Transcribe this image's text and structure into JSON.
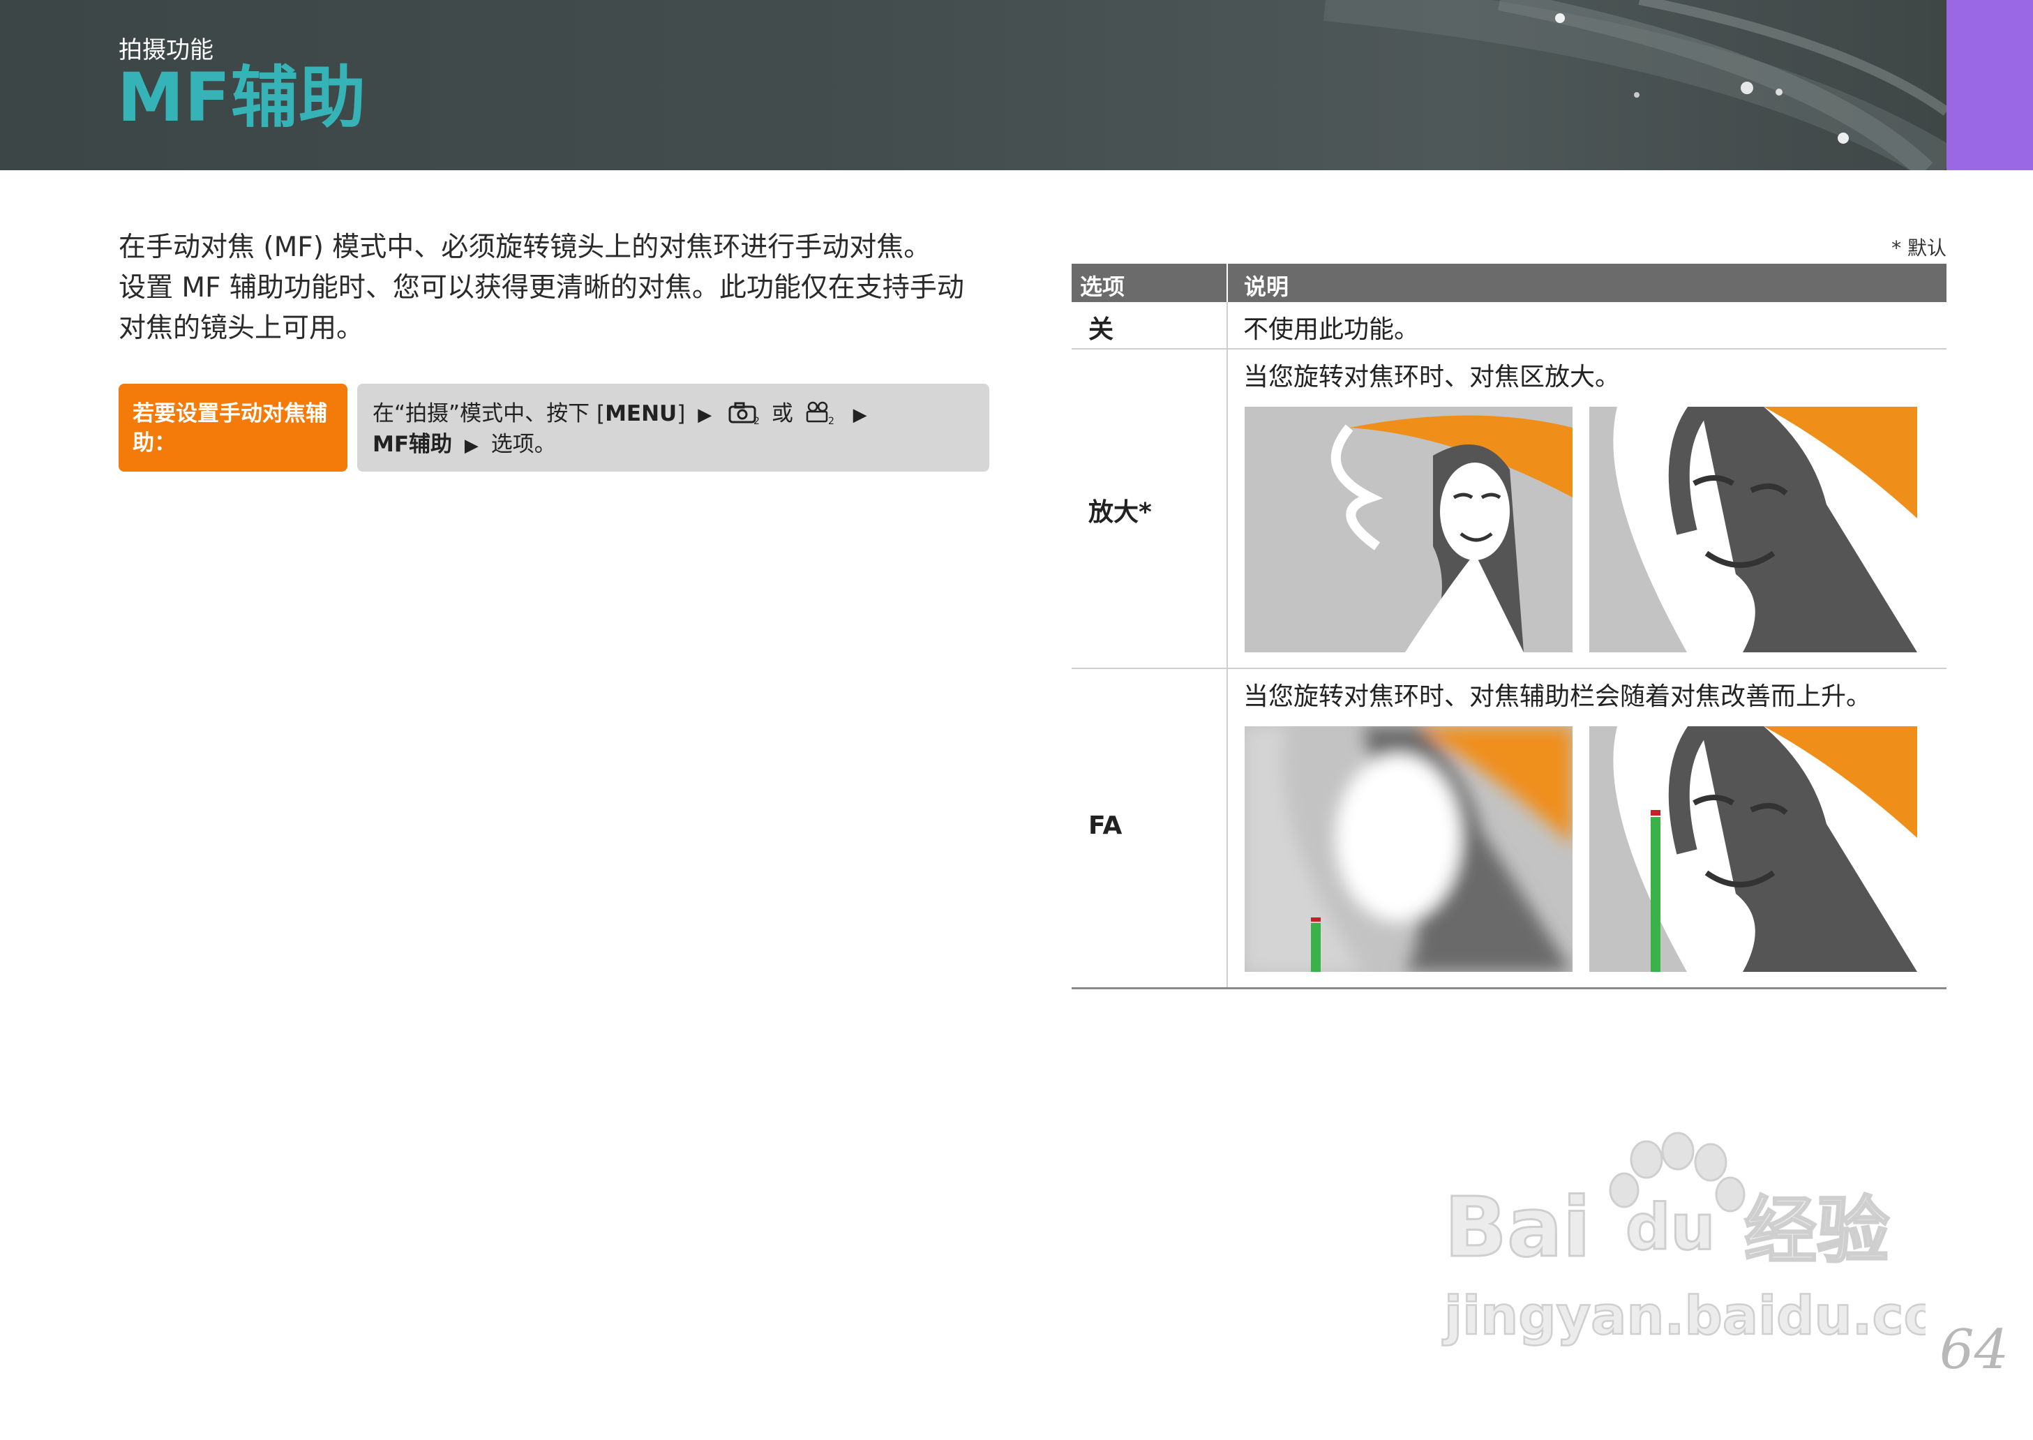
{
  "header": {
    "section_label": "拍摄功能",
    "title": "MF辅助",
    "accent_color": "#36b3b7",
    "tab_color": "#9a68e4"
  },
  "intro": {
    "line1": "在手动对焦 (MF) 模式中、必须旋转镜头上的对焦环进行手动对焦。",
    "line2": "设置 MF 辅助功能时、您可以获得更清晰的对焦。此功能仅在支持手动",
    "line3": "对焦的镜头上可用。"
  },
  "howto": {
    "label": "若要设置手动对焦辅助：",
    "step_prefix": "在“拍摄”模式中、按下 [",
    "menu_key": "MENU",
    "step_suffix": "]",
    "or_text": "或",
    "menu_item": "MF辅助",
    "end_text": "选项。",
    "arrow": "▶",
    "icons": [
      "camera-2-icon",
      "movie-camera-2-icon"
    ]
  },
  "table": {
    "default_note": "* 默认",
    "header_option": "选项",
    "header_desc": "说明",
    "rows": [
      {
        "option": "关",
        "desc": "不使用此功能。"
      },
      {
        "option": "放大*",
        "desc": "当您旋转对焦环时、对焦区放大。"
      },
      {
        "option": "FA",
        "desc": "当您旋转对焦环时、对焦辅助栏会随着对焦改善而上升。"
      }
    ]
  },
  "page_number": "64",
  "watermark": {
    "line1": "Bai",
    "line2": "du",
    "line3": "经验",
    "line4": "jingyan.baidu.com"
  }
}
